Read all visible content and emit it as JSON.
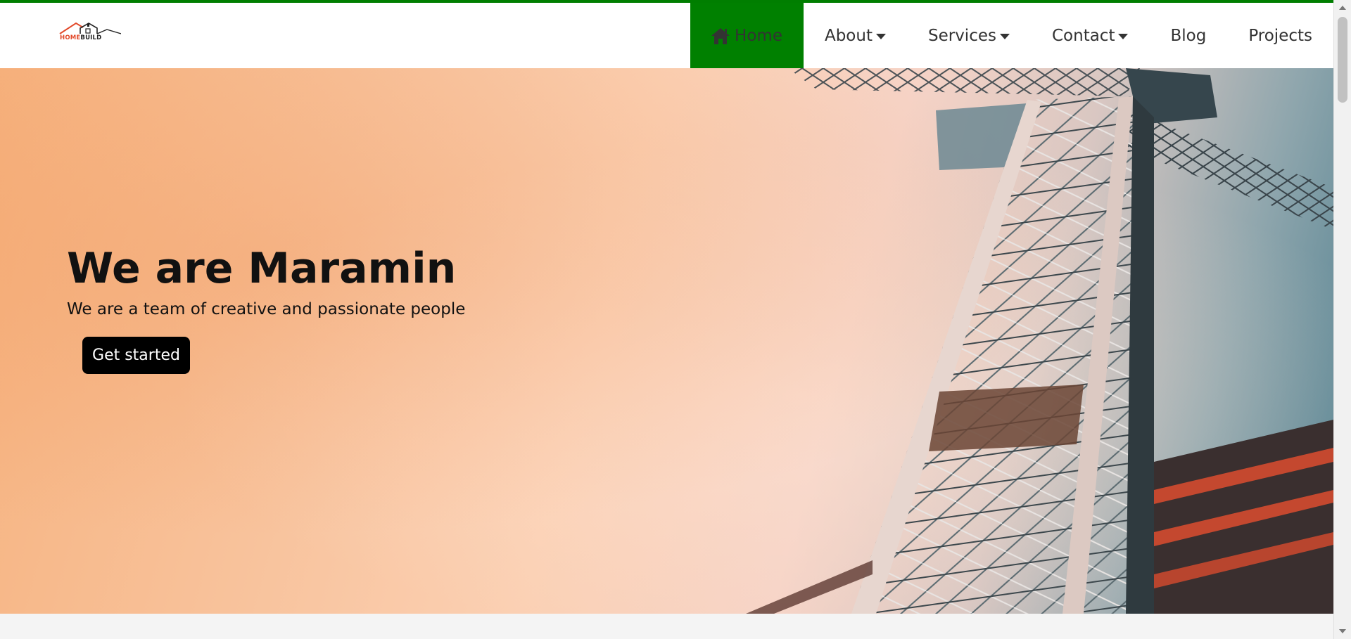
{
  "colors": {
    "accent": "#008000",
    "topline": "#007e00",
    "button_bg": "#000000",
    "logo_red": "#e2492a"
  },
  "logo": {
    "part1": "HOME",
    "part2": "BUILD"
  },
  "nav": {
    "home": {
      "label": "Home",
      "icon": "home-icon"
    },
    "about": {
      "label": "About"
    },
    "services": {
      "label": "Services"
    },
    "contact": {
      "label": "Contact"
    },
    "blog": {
      "label": "Blog"
    },
    "projects": {
      "label": "Projects"
    }
  },
  "hero": {
    "title": "We are Maramin",
    "subtitle": "We are a team of creative and passionate people",
    "cta_label": "Get started"
  }
}
